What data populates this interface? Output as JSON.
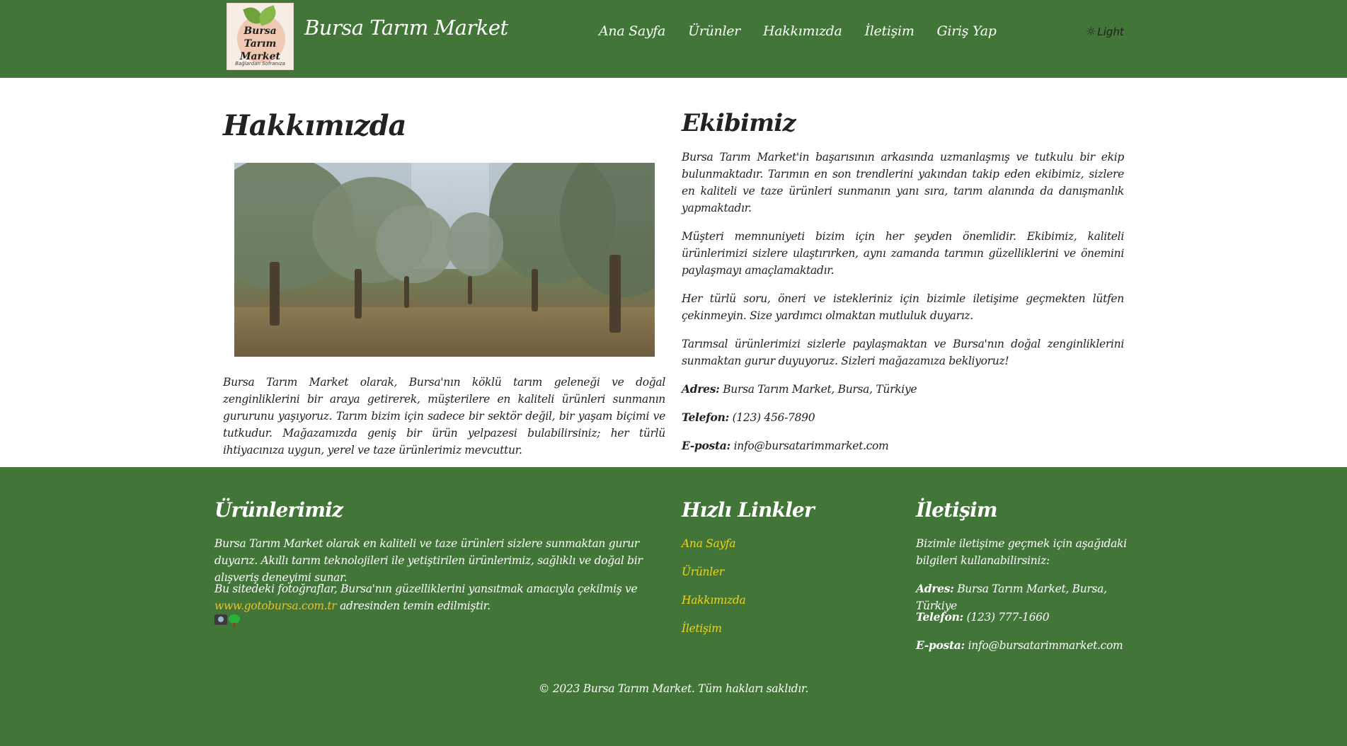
{
  "header": {
    "logo": {
      "line1": "Bursa Tarım",
      "line2": "Market",
      "tagline": "Bağlardan Sofranıza"
    },
    "site_title": "Bursa Tarım Market",
    "nav": [
      "Ana Sayfa",
      "Ürünler",
      "Hakkımızda",
      "İletişim",
      "Giriş Yap"
    ],
    "theme_toggle": {
      "icon": "sun-icon",
      "label": "Light"
    }
  },
  "about": {
    "title": "Hakkımızda",
    "image": {
      "subject": "olive-grove-photo"
    },
    "text": "Bursa Tarım Market olarak, Bursa'nın köklü tarım geleneği ve doğal zenginliklerini bir araya getirerek, müşterilere en kaliteli ürünleri sunmanın gururunu yaşıyoruz. Tarım bizim için sadece bir sektör değil, bir yaşam biçimi ve tutkudur. Mağazamızda geniş bir ürün yelpazesi bulabilirsiniz; her türlü ihtiyacınıza uygun, yerel ve taze ürünlerimiz mevcuttur."
  },
  "team": {
    "title": "Ekibimiz",
    "paragraphs": [
      "Bursa Tarım Market'in başarısının arkasında uzmanlaşmış ve tutkulu bir ekip bulunmaktadır. Tarımın en son trendlerini yakından takip eden ekibimiz, sizlere en kaliteli ve taze ürünleri sunmanın yanı sıra, tarım alanında da danışmanlık yapmaktadır.",
      "Müşteri memnuniyeti bizim için her şeyden önemlidir. Ekibimiz, kaliteli ürünlerimizi sizlere ulaştırırken, aynı zamanda tarımın güzelliklerini ve önemini paylaşmayı amaçlamaktadır.",
      "Her türlü soru, öneri ve istekleriniz için bizimle iletişime geçmekten lütfen çekinmeyin. Size yardımcı olmaktan mutluluk duyarız.",
      "Tarımsal ürünlerimizi sizlerle paylaşmaktan ve Bursa'nın doğal zenginliklerini sunmaktan gurur duyuyoruz. Sizleri mağazamıza bekliyoruz!"
    ],
    "address_label": "Adres:",
    "address": "Bursa Tarım Market, Bursa, Türkiye",
    "phone_label": "Telefon:",
    "phone": "(123) 456-7890",
    "email_label": "E-posta:",
    "email": "info@bursatarimmarket.com"
  },
  "footer": {
    "products": {
      "title": "Ürünlerimiz",
      "text": "Bursa Tarım Market olarak en kaliteli ve taze ürünleri sizlere sunmaktan gurur duyarız. Akıllı tarım teknolojileri ile yetiştirilen ürünlerimiz, sağlıklı ve doğal bir alışveriş deneyimi sunar.",
      "photo_note_before": "Bu sitedeki fotoğraflar, Bursa'nın güzelliklerini yansıtmak amacıyla çekilmiş ve",
      "photo_link": "www.gotobursa.com.tr",
      "photo_note_after": "adresinden temin edilmiştir.",
      "icons": [
        "camera-icon",
        "tree-icon"
      ]
    },
    "quick_links": {
      "title": "Hızlı Linkler",
      "items": [
        "Ana Sayfa",
        "Ürünler",
        "Hakkımızda",
        "İletişim"
      ]
    },
    "contact": {
      "title": "İletişim",
      "intro": "Bizimle iletişime geçmek için aşağıdaki bilgileri kullanabilirsiniz:",
      "address_label": "Adres:",
      "address": "Bursa Tarım Market, Bursa, Türkiye",
      "phone_label": "Telefon:",
      "phone": "(123) 777-1660",
      "email_label": "E-posta:",
      "email": "info@bursatarimmarket.com"
    },
    "copyright": "© 2023 Bursa Tarım Market. Tüm hakları saklıdır."
  },
  "colors": {
    "brand_green": "#427538",
    "link_yellow": "#f2d21b",
    "link_gold": "#e8c12c"
  }
}
